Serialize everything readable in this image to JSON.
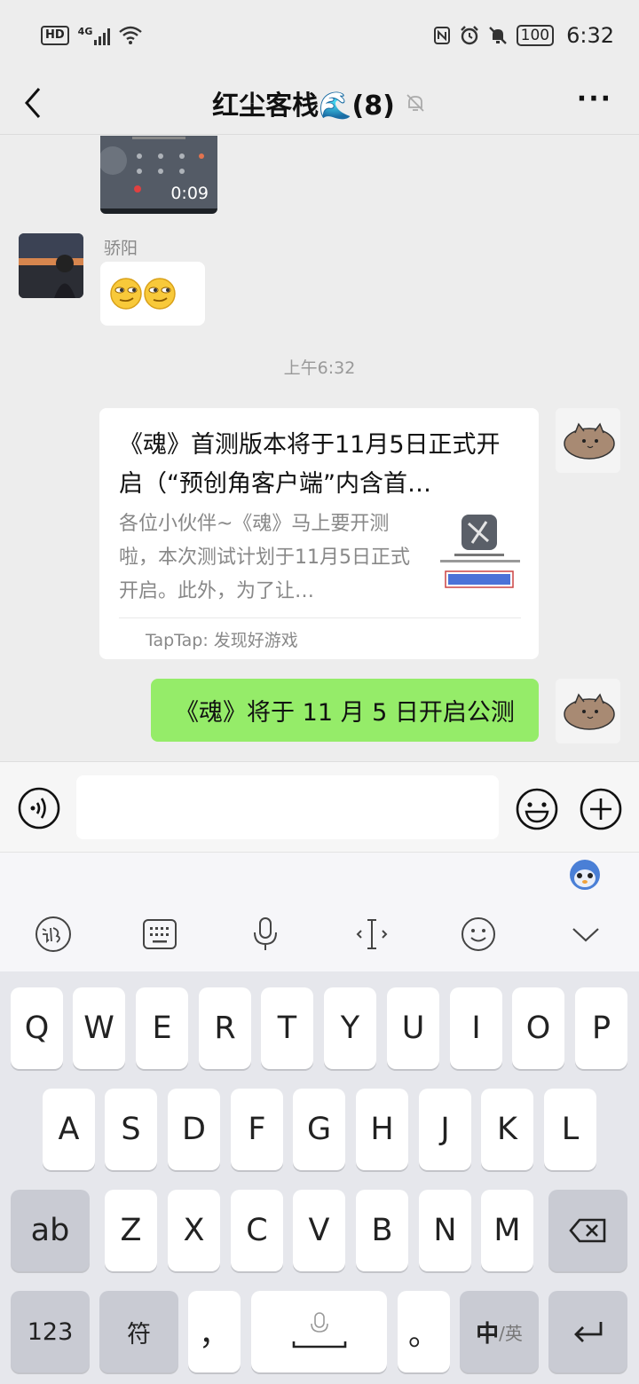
{
  "status_bar": {
    "left_badges": [
      "HD",
      "4G"
    ],
    "battery": "100",
    "time": "6:32"
  },
  "nav": {
    "title": "红尘客栈🌊(8)"
  },
  "chat": {
    "video_duration": "0:09",
    "sender_name": "骄阳",
    "emoji_message": "😏😏",
    "timestamp": "上午6:32",
    "link_card": {
      "title": "《魂》首测版本将于11月5日正式开启（“预创角客户端”内含首…",
      "description": "各位小伙伴~《魂》马上要开测啦，本次测试计划于11月5日正式开启。此外，为了让…",
      "source": "TapTap: 发现好游戏"
    },
    "sent_message": "《魂》将于 11 月 5 日开启公测"
  },
  "input_bar": {
    "placeholder": ""
  },
  "ime_toolbar": {
    "tools": [
      "handwriting-icon",
      "keyboard-icon",
      "mic-icon",
      "cursor-icon",
      "smiley-icon",
      "chevron-down-icon"
    ]
  },
  "keyboard": {
    "row1": [
      "Q",
      "W",
      "E",
      "R",
      "T",
      "Y",
      "U",
      "I",
      "O",
      "P"
    ],
    "row2": [
      "A",
      "S",
      "D",
      "F",
      "G",
      "H",
      "J",
      "K",
      "L"
    ],
    "row3_left": "ab",
    "row3": [
      "Z",
      "X",
      "C",
      "V",
      "B",
      "N",
      "M"
    ],
    "row4": {
      "num": "123",
      "symbol": "符",
      "comma": "，",
      "period": "。",
      "lang_main": "中",
      "lang_alt": "/英"
    }
  },
  "colors": {
    "sent_bubble": "#95ec69",
    "background": "#ededed",
    "keyboard_bg": "#e6e7ec"
  }
}
